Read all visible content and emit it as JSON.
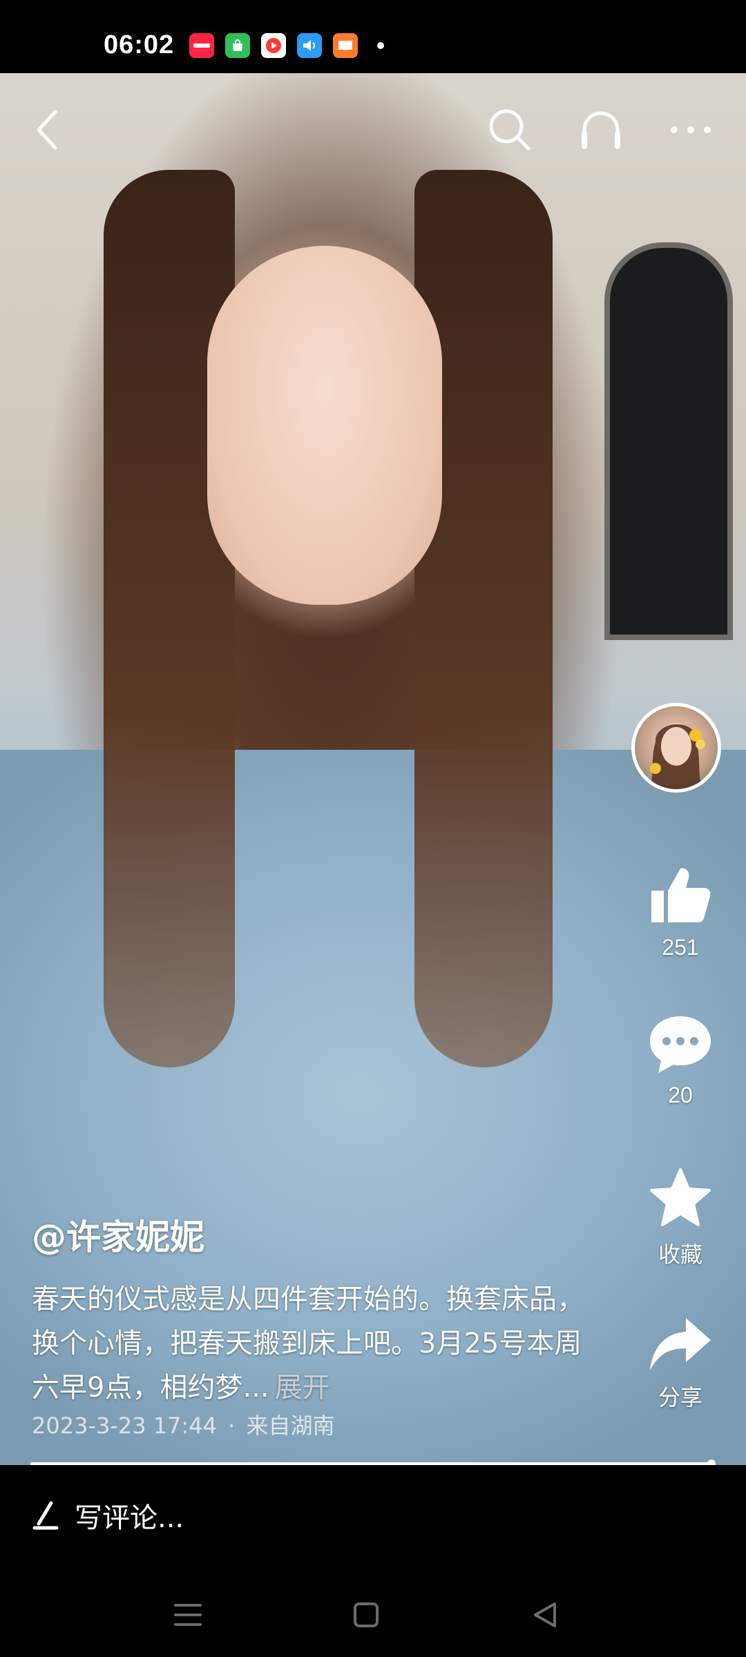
{
  "status_bar": {
    "time": "06:02",
    "notification_icons": [
      "xiaohongshu-app-icon",
      "shopping-bag-app-icon",
      "video-player-app-icon",
      "audio-app-icon",
      "reader-app-icon"
    ],
    "colors": {
      "xiaohongshu": "#ff2442",
      "shopping": "#2fbf5a",
      "video": "#ff3b30",
      "audio": "#2a9df4",
      "reader": "#ff7a2a"
    }
  },
  "top_bar": {
    "icons": {
      "back": "chevron-left-icon",
      "search": "search-icon",
      "listen": "headphones-icon",
      "more": "more-dots-icon"
    }
  },
  "actions": {
    "like_count": "251",
    "comment_count": "20",
    "collect_label": "收藏",
    "share_label": "分享"
  },
  "post": {
    "author": "@许家妮妮",
    "description": "春天的仪式感是从四件套开始的。换套床品，换个心情，把春天搬到床上吧。3月25号本周六早9点，相约梦...",
    "expand_label": "展开",
    "date": "2023-3-23 17:44",
    "separator": "·",
    "location": "来自湖南"
  },
  "playback": {
    "progress_fraction": 0.994
  },
  "comment_bar": {
    "placeholder": "写评论..."
  },
  "nav_bar": {
    "icons": {
      "menu": "menu-icon",
      "home": "home-square-icon",
      "back": "back-triangle-icon"
    }
  }
}
